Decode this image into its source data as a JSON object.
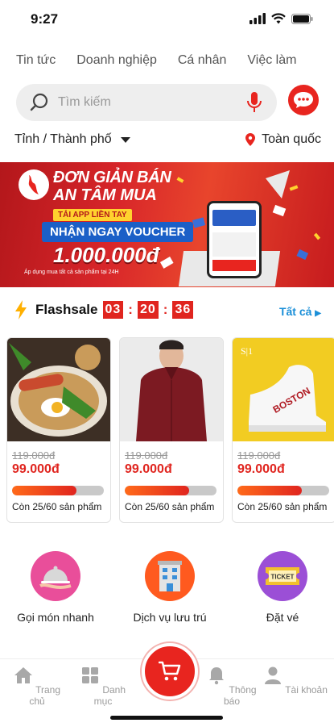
{
  "status": {
    "time": "9:27"
  },
  "categories": [
    "Tin tức",
    "Doanh nghiệp",
    "Cá nhân",
    "Việc làm"
  ],
  "search": {
    "placeholder": "Tìm kiếm"
  },
  "location": {
    "province_label": "Tỉnh / Thành phố",
    "nation_label": "Toàn quốc"
  },
  "banner": {
    "line1": "ĐƠN GIẢN BÁN",
    "line2": "AN TÂM MUA",
    "tag1": "TẢI APP LIỀN TAY",
    "tag2": "NHẬN NGAY VOUCHER",
    "amount": "1.000.000đ",
    "note": "Áp dụng mua tất cả sản phẩm tại 24H"
  },
  "flashsale": {
    "label": "Flashsale",
    "hours": "03",
    "minutes": "20",
    "seconds": "36",
    "see_all": "Tất cả"
  },
  "products": [
    {
      "old_price": "119.000đ",
      "new_price": "99.000đ",
      "remaining": "Còn 25/60 sản phẩm",
      "sold_fraction": 0.7
    },
    {
      "old_price": "119.000đ",
      "new_price": "99.000đ",
      "remaining": "Còn 25/60 sản phẩm",
      "sold_fraction": 0.7
    },
    {
      "old_price": "119.000đ",
      "new_price": "99.000đ",
      "remaining": "Còn 25/60 sản phẩm",
      "sold_fraction": 0.7
    }
  ],
  "product_image_texts": {
    "shoe_brand": "S|1",
    "shoe_text": "BOSTON"
  },
  "services": [
    {
      "name": "Gọi món nhanh",
      "icon": "food-cloche-icon",
      "color": "#e94e9a"
    },
    {
      "name": "Dịch vụ lưu trú",
      "icon": "hotel-building-icon",
      "color": "#ff5a1f"
    },
    {
      "name": "Đặt vé",
      "icon": "ticket-icon",
      "color": "#9b4fd6"
    }
  ],
  "ticket_text": "TICKET",
  "tabs": [
    {
      "label": "Trang chủ",
      "icon": "home-icon"
    },
    {
      "label": "Danh mục",
      "icon": "grid-icon"
    },
    {
      "label": "Thông báo",
      "icon": "bell-icon"
    },
    {
      "label": "Tài khoản",
      "icon": "user-icon"
    }
  ],
  "colors": {
    "brand": "#e8251f",
    "link": "#1a8fd8"
  }
}
